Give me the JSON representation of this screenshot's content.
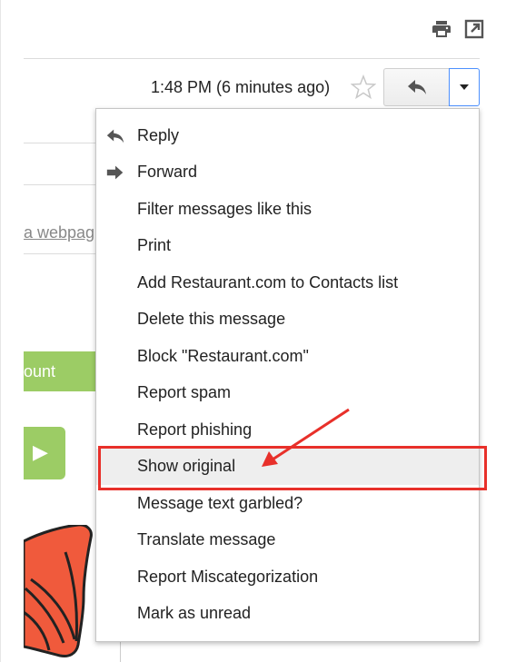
{
  "header": {
    "timestamp": "1:48 PM (6 minutes ago)"
  },
  "background": {
    "link_fragment": "a webpag",
    "green_button_fragment": "ount",
    "play_glyph": "▶"
  },
  "menu": {
    "items": [
      {
        "label": "Reply",
        "icon": "reply-icon"
      },
      {
        "label": "Forward",
        "icon": "forward-icon"
      },
      {
        "label": "Filter messages like this"
      },
      {
        "label": "Print"
      },
      {
        "label": "Add Restaurant.com to Contacts list"
      },
      {
        "label": "Delete this message"
      },
      {
        "label": "Block \"Restaurant.com\""
      },
      {
        "label": "Report spam"
      },
      {
        "label": "Report phishing"
      },
      {
        "label": "Show original",
        "highlighted": true
      },
      {
        "label": "Message text garbled?"
      },
      {
        "label": "Translate message"
      },
      {
        "label": "Report Miscategorization"
      },
      {
        "label": "Mark as unread"
      }
    ]
  },
  "colors": {
    "annotation_red": "#e8302a",
    "green": "#9ccc65",
    "focus_blue": "#4d90fe",
    "hover_gray": "#eeeeee"
  }
}
